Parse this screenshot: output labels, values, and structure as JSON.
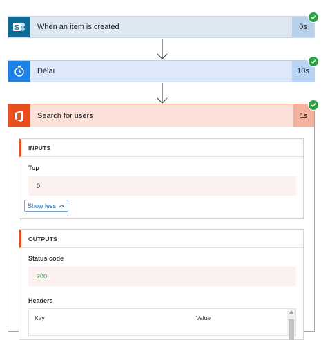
{
  "steps": [
    {
      "title": "When an item is created",
      "duration": "0s"
    },
    {
      "title": "Délai",
      "duration": "10s"
    }
  ],
  "expanded_step": {
    "title": "Search for users",
    "duration": "1s",
    "inputs": {
      "header": "INPUTS",
      "param_label": "Top",
      "param_value": "0",
      "show_less": "Show less"
    },
    "outputs": {
      "header": "OUTPUTS",
      "status_label": "Status code",
      "status_value": "200",
      "headers_label": "Headers",
      "table_columns": [
        "Key",
        "Value"
      ]
    }
  },
  "colors": {
    "sharepoint": "#0f6b96",
    "timer": "#1d82e6",
    "office": "#e94f1c",
    "success": "#2f9e44",
    "status_value": "#2d8a4a"
  },
  "icons": [
    "sharepoint-icon",
    "timer-icon",
    "office-icon",
    "check-icon",
    "arrow-down-icon",
    "chevron-up-icon"
  ]
}
